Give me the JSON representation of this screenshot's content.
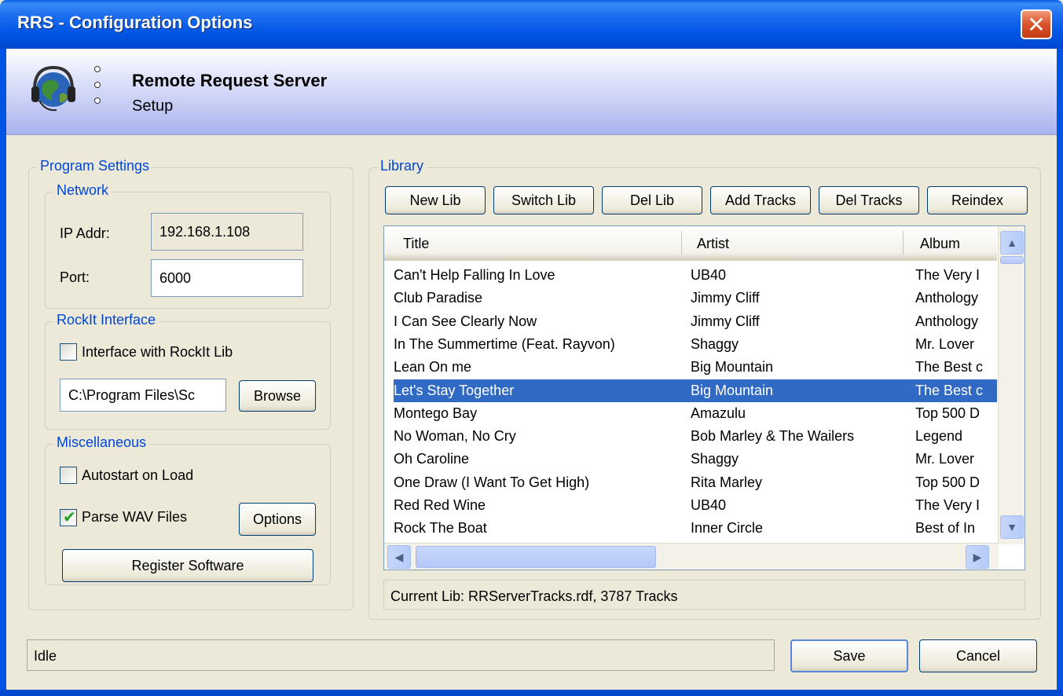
{
  "window": {
    "title": "RRS - Configuration Options",
    "close_glyph": "✕"
  },
  "banner": {
    "heading": "Remote Request Server",
    "subheading": "Setup",
    "icon": "globe-headphones-icon"
  },
  "program_settings": {
    "legend": "Program Settings",
    "network": {
      "legend": "Network",
      "ip_label": "IP Addr:",
      "ip_value": "192.168.1.108",
      "port_label": "Port:",
      "port_value": "6000"
    },
    "rockit": {
      "legend": "RockIt Interface",
      "interface_label": "Interface with RockIt Lib",
      "interface_checked": false,
      "path_value": "C:\\Program Files\\Sc",
      "browse_label": "Browse"
    },
    "misc": {
      "legend": "Miscellaneous",
      "autostart_label": "Autostart on Load",
      "autostart_checked": false,
      "parse_wav_label": "Parse WAV Files",
      "parse_wav_checked": true,
      "options_label": "Options",
      "register_label": "Register Software"
    }
  },
  "library": {
    "legend": "Library",
    "buttons": {
      "new_lib": "New Lib",
      "switch_lib": "Switch Lib",
      "del_lib": "Del Lib",
      "add_tracks": "Add Tracks",
      "del_tracks": "Del Tracks",
      "reindex": "Reindex"
    },
    "columns": [
      "Title",
      "Artist",
      "Album"
    ],
    "rows": [
      [
        "Can't Help Falling In Love",
        "UB40",
        "The Very I"
      ],
      [
        "Club Paradise",
        "Jimmy Cliff",
        "Anthology"
      ],
      [
        "I Can See Clearly Now",
        "Jimmy Cliff",
        "Anthology"
      ],
      [
        "In The Summertime  (Feat. Rayvon)",
        "Shaggy",
        "Mr. Lover"
      ],
      [
        "Lean On me",
        "Big Mountain",
        "The Best c"
      ],
      [
        "Let's Stay Together",
        "Big Mountain",
        "The Best c"
      ],
      [
        "Montego Bay",
        "Amazulu",
        "Top 500 D"
      ],
      [
        "No Woman, No Cry",
        "Bob Marley & The Wailers",
        "Legend"
      ],
      [
        "Oh Caroline",
        "Shaggy",
        "Mr. Lover"
      ],
      [
        "One Draw (I Want To Get High)",
        "Rita Marley",
        "Top 500 D"
      ],
      [
        "Red Red Wine",
        "UB40",
        "The Very I"
      ],
      [
        "Rock The Boat",
        "Inner Circle",
        "Best of In"
      ]
    ],
    "selected_row": 5,
    "current_lib": "Current Lib: RRServerTracks.rdf, 3787 Tracks"
  },
  "footer": {
    "status": "Idle",
    "save_label": "Save",
    "cancel_label": "Cancel"
  },
  "colors": {
    "titlebar": "#0054e3",
    "selection": "#316ac5",
    "group_legend": "#0046d5",
    "window_bg": "#ece9d8"
  }
}
